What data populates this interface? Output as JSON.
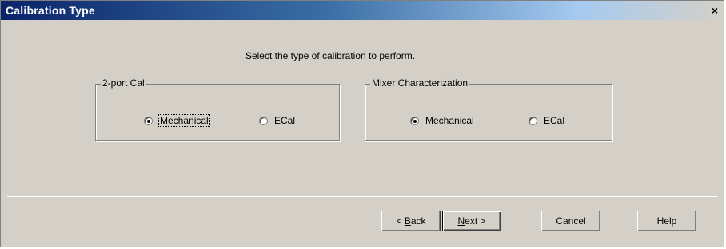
{
  "window": {
    "title": "Calibration Type",
    "close_icon": "close-icon"
  },
  "prompt": "Select the type of calibration to perform.",
  "groups": [
    {
      "legend": "2-port Cal",
      "options": [
        {
          "label": "Mechanical",
          "checked": true,
          "focused": true
        },
        {
          "label": "ECal",
          "checked": false
        }
      ]
    },
    {
      "legend": "Mixer Characterization",
      "options": [
        {
          "label": "Mechanical",
          "checked": true
        },
        {
          "label": "ECal",
          "checked": false
        }
      ]
    }
  ],
  "buttons": {
    "back": {
      "prefix": "< ",
      "mnemonic": "B",
      "rest": "ack"
    },
    "next": {
      "mnemonic": "N",
      "rest": "ext >"
    },
    "cancel": "Cancel",
    "help": "Help"
  }
}
